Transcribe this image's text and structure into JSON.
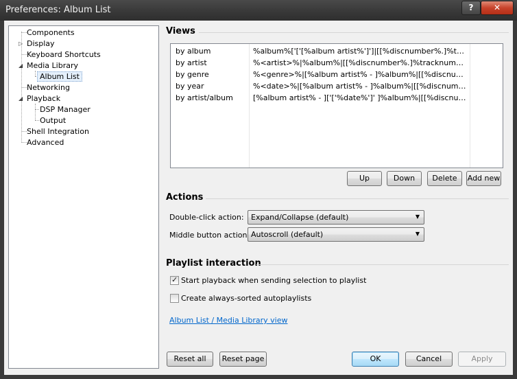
{
  "window": {
    "title": "Preferences: Album List",
    "help_label": "?",
    "close_label": "✕"
  },
  "tree": {
    "items": [
      {
        "label": "Components"
      },
      {
        "label": "Display"
      },
      {
        "label": "Keyboard Shortcuts"
      },
      {
        "label": "Media Library"
      },
      {
        "label": "Album List",
        "selected": true
      },
      {
        "label": "Networking"
      },
      {
        "label": "Playback"
      },
      {
        "label": "DSP Manager"
      },
      {
        "label": "Output"
      },
      {
        "label": "Shell Integration"
      },
      {
        "label": "Advanced"
      }
    ]
  },
  "views": {
    "title": "Views",
    "rows": [
      {
        "name": "by album",
        "pattern": "%album%['['[%album artist%']']|[[%discnumber%.]%tracknumber%. ][%track artist% - ]%title%"
      },
      {
        "name": "by artist",
        "pattern": "%<artist>%|%album%|[[%discnumber%.]%tracknumber%. ]%title%"
      },
      {
        "name": "by genre",
        "pattern": "%<genre>%|[%album artist% - ]%album%|[[%discnumber%.]%tracknumber%. ]%title%"
      },
      {
        "name": "by year",
        "pattern": "%<date>%|[%album artist% - ]%album%|[[%discnumber%.]%tracknumber%. ]%title%"
      },
      {
        "name": "by artist/album",
        "pattern": "[%album artist% - ]['['%date%']' ]%album%|[[%discnumber%.]%tracknumber%. ]%title%"
      }
    ],
    "buttons": {
      "up": "Up",
      "down": "Down",
      "delete": "Delete",
      "add_new": "Add new"
    }
  },
  "actions": {
    "title": "Actions",
    "double_click_label": "Double-click action:",
    "double_click_value": "Expand/Collapse (default)",
    "middle_button_label": "Middle button action:",
    "middle_button_value": "Autoscroll (default)"
  },
  "playlist": {
    "title": "Playlist interaction",
    "start_playback_label": "Start playback when sending selection to playlist",
    "start_playback_checked": true,
    "always_sorted_label": "Create always-sorted autoplaylists",
    "always_sorted_checked": false,
    "link_text": "Album List / Media Library view"
  },
  "footer": {
    "reset_all": "Reset all",
    "reset_page": "Reset page",
    "ok": "OK",
    "cancel": "Cancel",
    "apply": "Apply"
  }
}
